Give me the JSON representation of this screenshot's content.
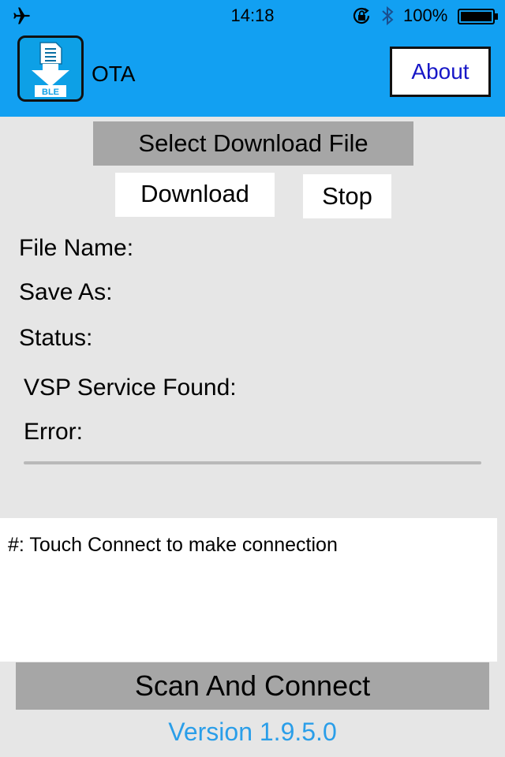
{
  "status_bar": {
    "time": "14:18",
    "battery_percent": "100%",
    "icons": [
      "airplane-icon",
      "rotation-lock-icon",
      "bluetooth-icon",
      "battery-icon"
    ]
  },
  "nav": {
    "logo_text": "BLE",
    "title": "OTA",
    "about_label": "About"
  },
  "main": {
    "select_file_label": "Select Download File",
    "download_label": "Download",
    "stop_label": "Stop",
    "file_name_label": "File Name:",
    "save_as_label": "Save As:",
    "status_label": "Status:",
    "vsp_label": "VSP Service Found:",
    "error_label": "Error:",
    "progress": 0
  },
  "log": {
    "text": "#: Touch Connect to make connection"
  },
  "footer": {
    "scan_label": "Scan And Connect",
    "version": "Version 1.9.5.0"
  },
  "colors": {
    "accent": "#12a0f2",
    "background": "#e6e6e6",
    "button_gray": "#a6a6a6",
    "about_text": "#1717c7",
    "version_text": "#2a9ee9"
  }
}
